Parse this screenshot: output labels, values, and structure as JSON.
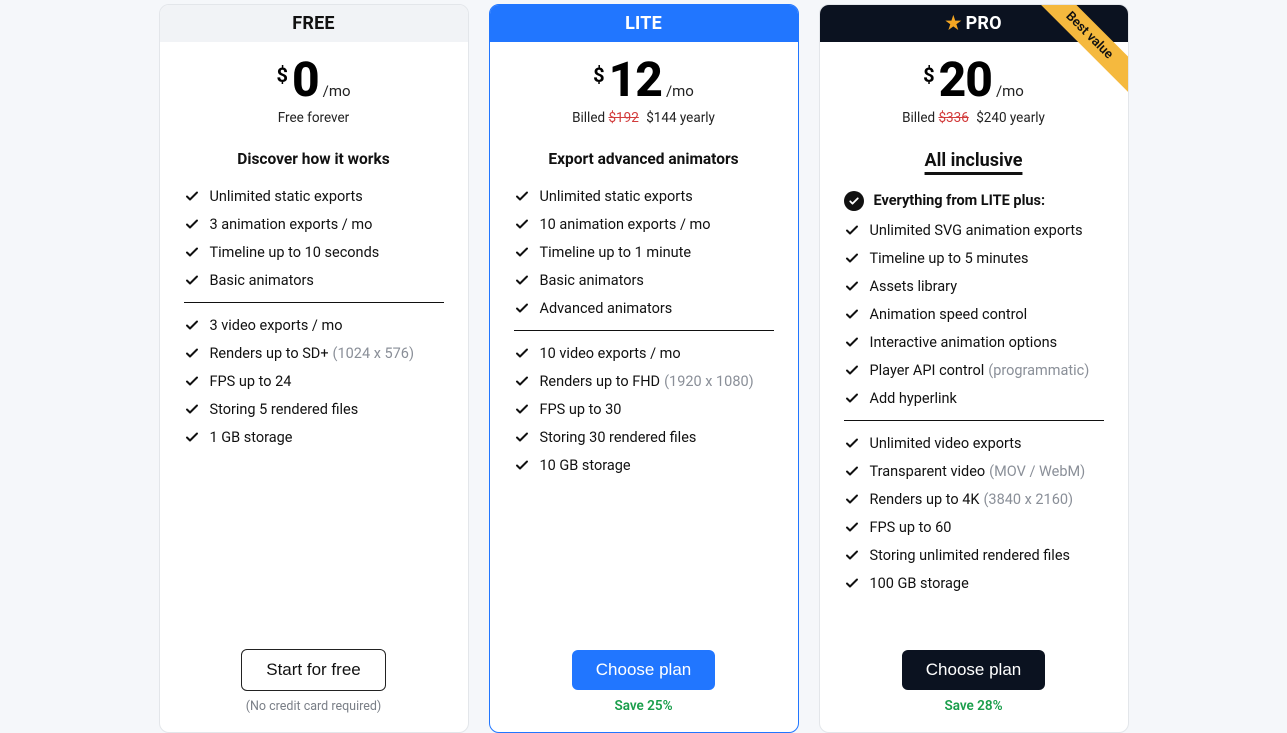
{
  "plans": {
    "free": {
      "title": "FREE",
      "currency": "$",
      "price": "0",
      "per": "/mo",
      "sub_price": "Free forever",
      "headline": "Discover how it works",
      "features_a": [
        "Unlimited static exports",
        "3 animation exports / mo",
        "Timeline up to 10 seconds",
        "Basic animators"
      ],
      "features_b": [
        {
          "text": "3 video exports / mo"
        },
        {
          "text": "Renders up to SD+",
          "note": "(1024 x 576)"
        },
        {
          "text": "FPS up to 24"
        },
        {
          "text": "Storing 5 rendered files"
        },
        {
          "text": "1 GB storage"
        }
      ],
      "cta": "Start for free",
      "cta_sub": "(No credit card required)"
    },
    "lite": {
      "title": "LITE",
      "currency": "$",
      "price": "12",
      "per": "/mo",
      "billed_prefix": "Billed",
      "billed_strike": "$192",
      "billed_now": "$144 yearly",
      "headline": "Export advanced animators",
      "features_a": [
        "Unlimited static exports",
        "10 animation exports / mo",
        "Timeline up to 1 minute",
        "Basic animators",
        "Advanced animators"
      ],
      "features_b": [
        {
          "text": "10 video exports / mo"
        },
        {
          "text": "Renders up to FHD",
          "note": "(1920 x 1080)"
        },
        {
          "text": "FPS up to 30"
        },
        {
          "text": "Storing 30 rendered files"
        },
        {
          "text": "10 GB storage"
        }
      ],
      "cta": "Choose plan",
      "cta_sub": "Save 25%"
    },
    "pro": {
      "title": "PRO",
      "ribbon": "Best value",
      "currency": "$",
      "price": "20",
      "per": "/mo",
      "billed_prefix": "Billed",
      "billed_strike": "$336",
      "billed_now": "$240 yearly",
      "headline": "All inclusive",
      "everything_from": "Everything from LITE plus:",
      "features_a": [
        {
          "text": "Unlimited SVG animation exports"
        },
        {
          "text": "Timeline up to 5 minutes"
        },
        {
          "text": "Assets library"
        },
        {
          "text": "Animation speed control"
        },
        {
          "text": "Interactive animation options"
        },
        {
          "text": "Player API control",
          "note": "(programmatic)"
        },
        {
          "text": "Add hyperlink"
        }
      ],
      "features_b": [
        {
          "text": "Unlimited video exports"
        },
        {
          "text": "Transparent video",
          "note": "(MOV / WebM)"
        },
        {
          "text": "Renders up to 4K",
          "note": "(3840 x 2160)"
        },
        {
          "text": "FPS up to 60"
        },
        {
          "text": "Storing unlimited rendered files"
        },
        {
          "text": "100 GB storage"
        }
      ],
      "cta": "Choose plan",
      "cta_sub": "Save 28%"
    }
  }
}
